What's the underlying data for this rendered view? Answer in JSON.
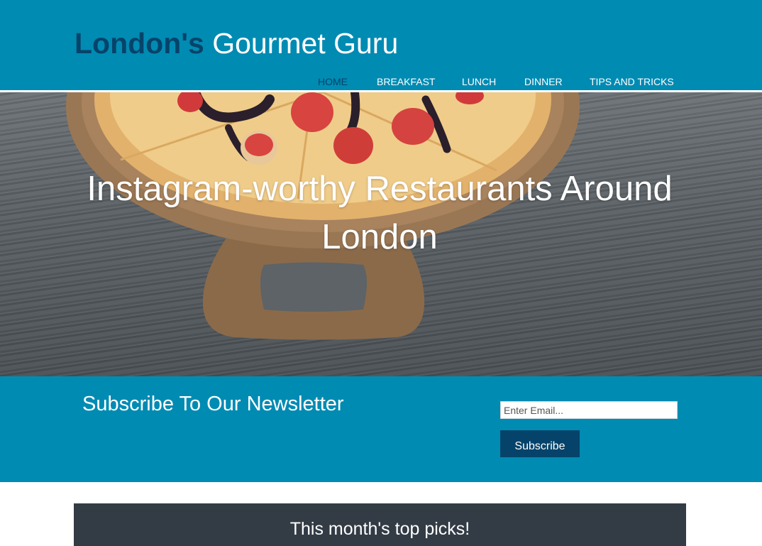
{
  "header": {
    "brand_accent": "London's",
    "brand_rest": " Gourmet Guru",
    "nav": [
      {
        "label": "HOME",
        "active": true
      },
      {
        "label": "BREAKFAST",
        "active": false
      },
      {
        "label": "LUNCH",
        "active": false
      },
      {
        "label": "DINNER",
        "active": false
      },
      {
        "label": "TIPS AND TRICKS",
        "active": false
      }
    ]
  },
  "hero": {
    "title": "Instagram-worthy Restaurants Around London",
    "image": "pizza-with-strawberries-on-wooden-board"
  },
  "newsletter": {
    "title": "Subscribe To Our Newsletter",
    "email_placeholder": "Enter Email...",
    "email_value": "",
    "subscribe_label": "Subscribe"
  },
  "picks": {
    "title": "This month's top picks!"
  },
  "colors": {
    "brand_blue": "#008bb3",
    "navy": "#06436a",
    "dark_panel": "#333c45",
    "white": "#ffffff"
  }
}
